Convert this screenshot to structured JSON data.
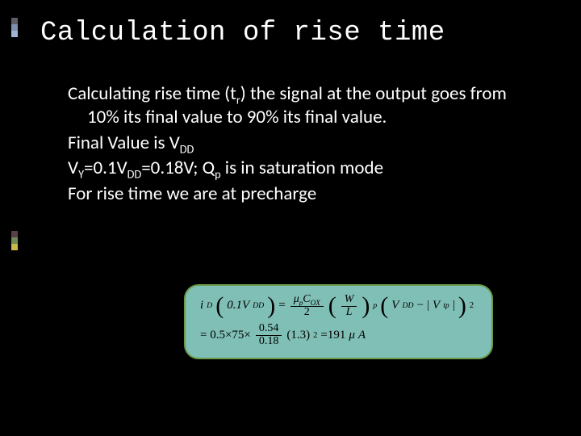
{
  "title": "Calculation of rise time",
  "body": {
    "p1_a": "Calculating rise time (t",
    "p1_sub": "r",
    "p1_b": ") the signal at the output goes from 10% its final value to 90% its final value.",
    "p2_a": "Final Value is V",
    "p2_sub": "DD",
    "p3_a": "V",
    "p3_sub1": "Y",
    "p3_b": "=0.1V",
    "p3_sub2": "DD",
    "p3_c": "=0.18V; Q",
    "p3_sub3": "p",
    "p3_d": " is in saturation mode",
    "p4": "For rise time we are at precharge"
  },
  "equation": {
    "lhs_i": "i",
    "lhs_D": "D",
    "lhs_arg_a": "0.1V",
    "lhs_arg_sub": "DD",
    "eq": "=",
    "frac1_num_mu": "μ",
    "frac1_num_p": "p",
    "frac1_num_C": "C",
    "frac1_num_OX": "OX",
    "frac1_den": "2",
    "frac2_num": "W",
    "frac2_den": "L",
    "frac2_sub": "p",
    "rhs_V": "V",
    "rhs_DD": "DD",
    "rhs_minus": " − ",
    "rhs_Vtp_a": "V",
    "rhs_Vtp_sub": "tp",
    "rhs_sq": "2",
    "row2_a": "= 0.5×75×",
    "row2_frac_num": "0.54",
    "row2_frac_den": "0.18",
    "row2_b": "(1.3)",
    "row2_sq": "2",
    "row2_c": " =191",
    "row2_mu": "μ",
    "row2_d": "A"
  }
}
